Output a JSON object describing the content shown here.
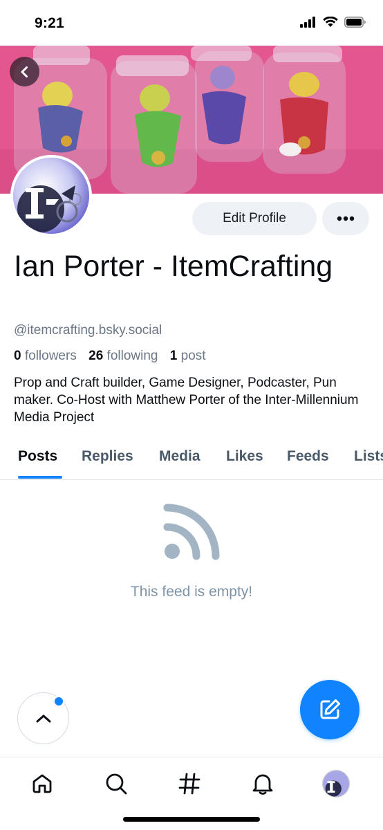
{
  "status_bar": {
    "time": "9:21"
  },
  "profile": {
    "display_name": "Ian Porter - ItemCrafting",
    "handle": "@itemcrafting.bsky.social",
    "followers_count": "0",
    "followers_label": "followers",
    "following_count": "26",
    "following_label": "following",
    "posts_count": "1",
    "posts_label": "post",
    "bio": "Prop and Craft builder, Game Designer, Podcaster, Pun maker. Co-Host with Matthew Porter of the Inter-Millennium Media Project"
  },
  "actions": {
    "edit_profile_label": "Edit Profile"
  },
  "tabs": [
    {
      "label": "Posts",
      "active": true
    },
    {
      "label": "Replies"
    },
    {
      "label": "Media"
    },
    {
      "label": "Likes"
    },
    {
      "label": "Feeds"
    },
    {
      "label": "Lists"
    }
  ],
  "feed": {
    "empty_text": "This feed is empty!"
  },
  "icons": {
    "back": "chevron-left-icon",
    "more": "ellipsis-icon",
    "empty_feed": "rss-icon",
    "scroll_top": "chevron-up-icon",
    "compose": "edit-icon",
    "nav": [
      "home-icon",
      "search-icon",
      "hashtag-icon",
      "bell-icon",
      "profile-avatar"
    ]
  },
  "colors": {
    "accent": "#1083fe",
    "banner_background": "#e3568e",
    "muted_text": "#6b7785",
    "empty_icon": "#a3b4c5"
  }
}
